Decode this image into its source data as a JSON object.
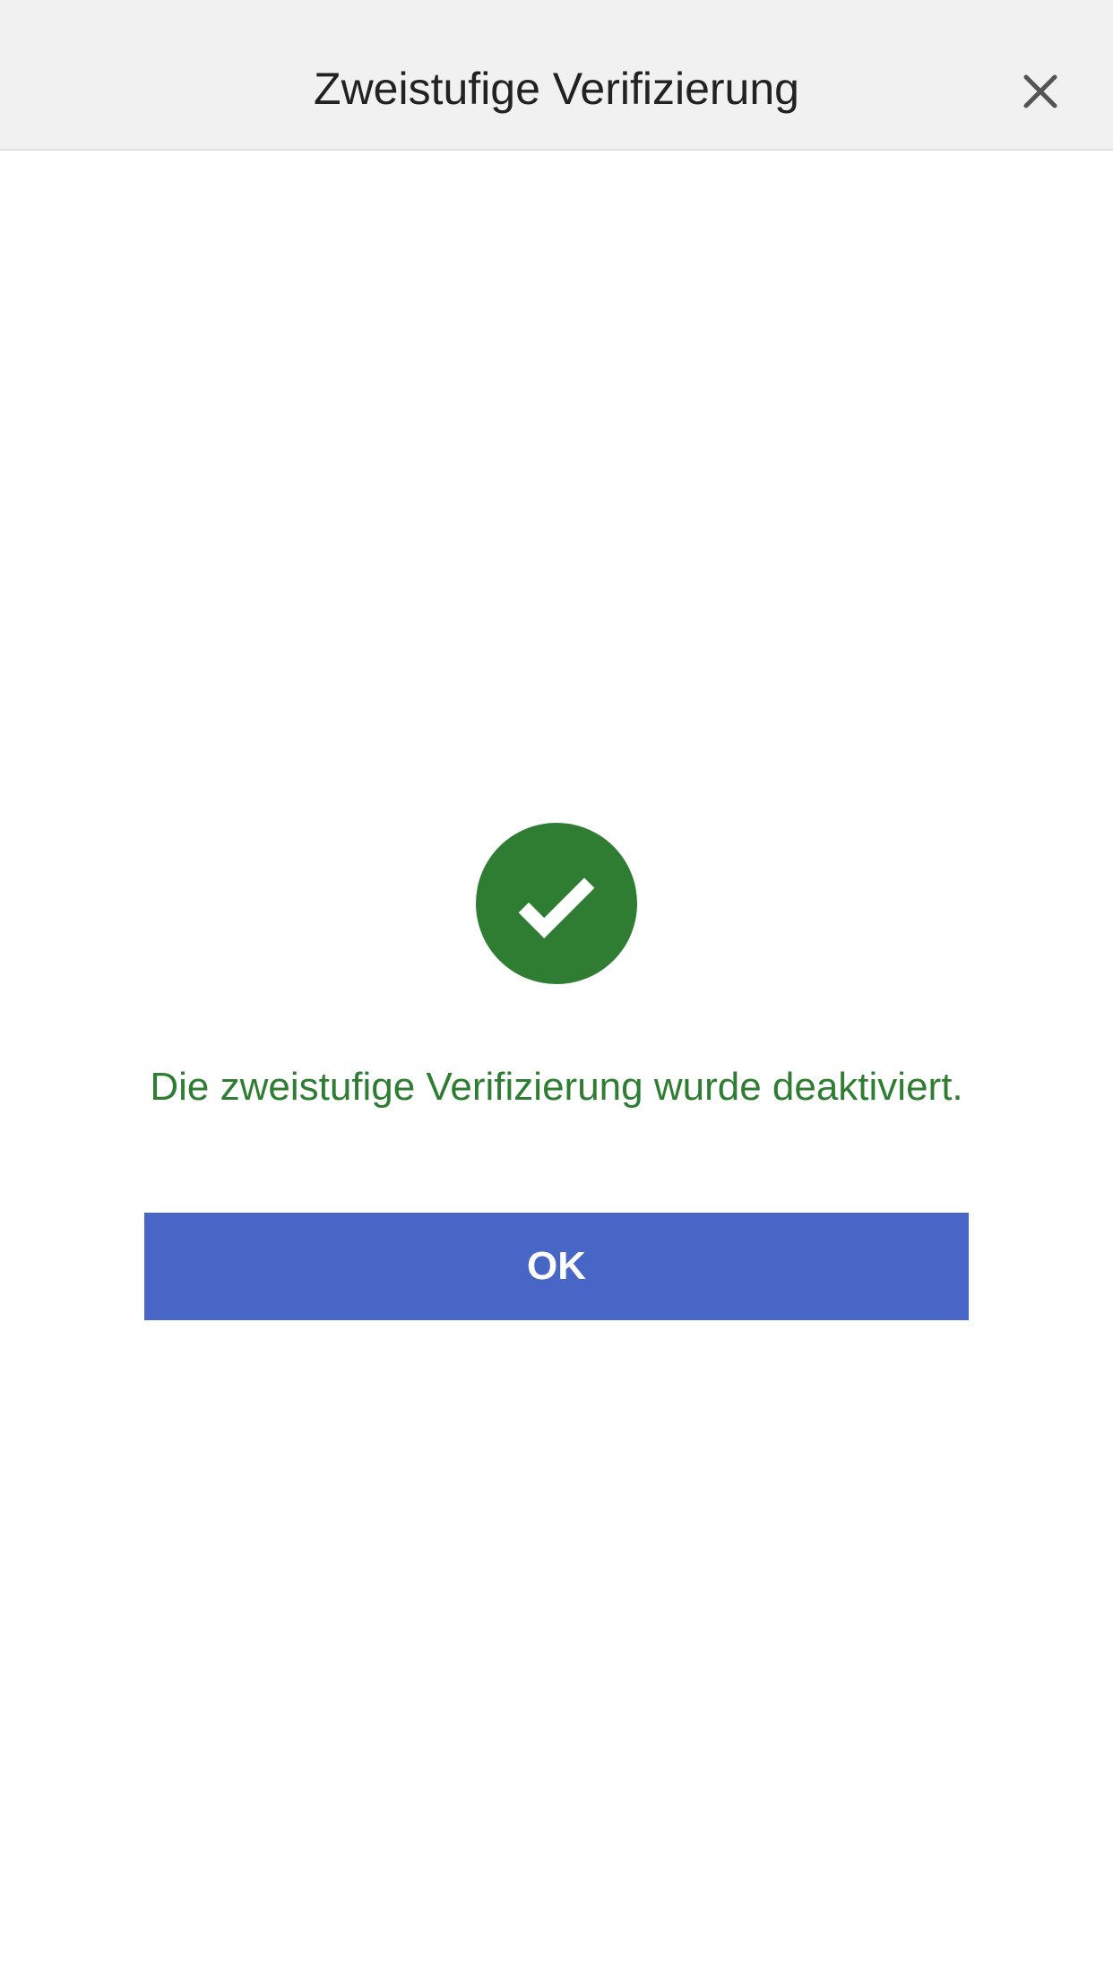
{
  "header": {
    "title": "Zweistufige Verifizierung"
  },
  "content": {
    "status_message": "Die zweistufige Verifizierung wurde deaktiviert.",
    "ok_label": "OK"
  },
  "colors": {
    "success_green": "#2e7d32",
    "button_blue": "#4866c6",
    "header_bg": "#f1f1f1"
  }
}
